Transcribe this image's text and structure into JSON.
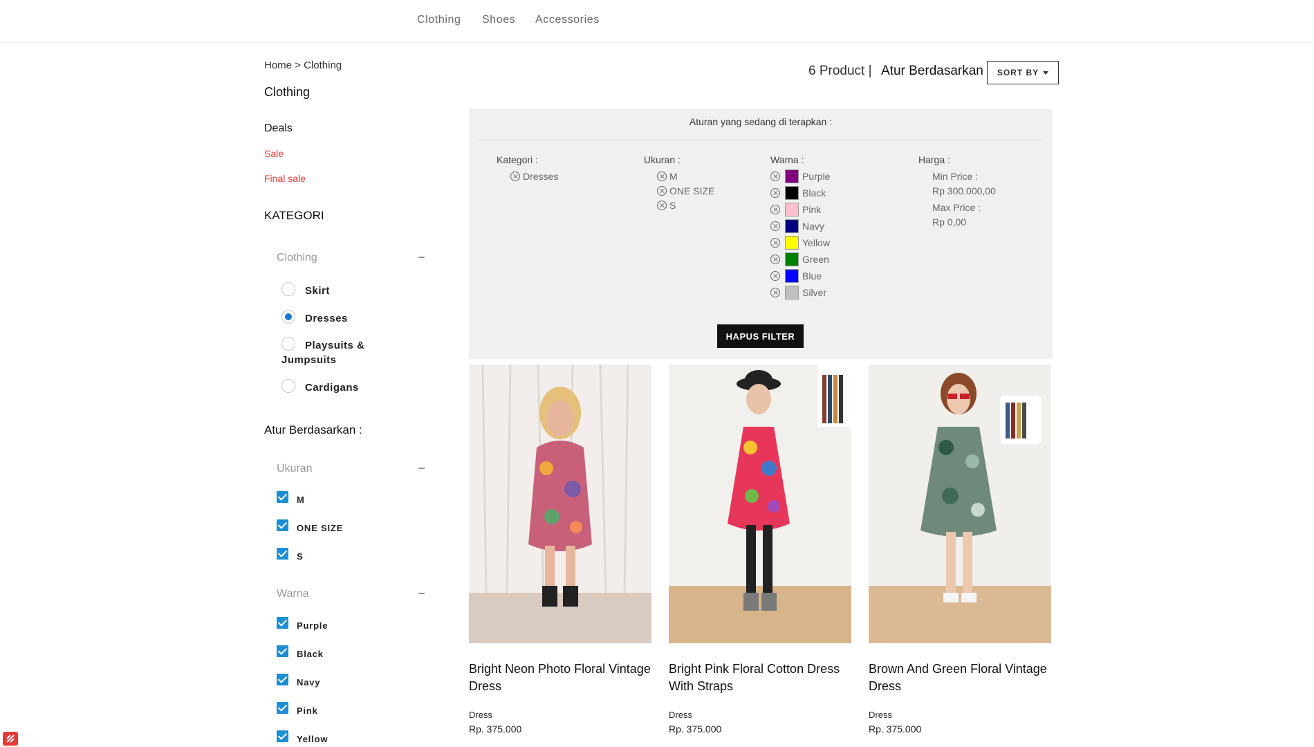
{
  "nav": {
    "items": [
      {
        "label": "Clothing"
      },
      {
        "label": "Shoes"
      },
      {
        "label": "Accessories"
      }
    ]
  },
  "sidebar": {
    "breadcrumb": "Home > Clothing",
    "page_title": "Clothing",
    "deals_title": "Deals",
    "deal_links": [
      "Sale",
      "Final sale"
    ],
    "category_title": "KATEGORI",
    "clothing_group": {
      "label": "Clothing",
      "toggle": "–",
      "options": [
        {
          "label": "Skirt",
          "selected": false
        },
        {
          "label": "Dresses",
          "selected": true
        },
        {
          "label": "Playsuits &",
          "label2": "Jumpsuits",
          "selected": false
        },
        {
          "label": "Cardigans",
          "selected": false
        }
      ]
    },
    "sort_title": "Atur Berdasarkan :",
    "size_group": {
      "label": "Ukuran",
      "toggle": "–",
      "options": [
        {
          "label": "M",
          "checked": true
        },
        {
          "label": "ONE SIZE",
          "checked": true
        },
        {
          "label": "S",
          "checked": true
        }
      ]
    },
    "color_group": {
      "label": "Warna",
      "toggle": "–",
      "options": [
        {
          "label": "Purple",
          "checked": true
        },
        {
          "label": "Black",
          "checked": true
        },
        {
          "label": "Navy",
          "checked": true
        },
        {
          "label": "Pink",
          "checked": true
        },
        {
          "label": "Yellow",
          "checked": true
        }
      ]
    }
  },
  "header": {
    "count": "6 Product |",
    "sort_label": "Atur Berdasarkan",
    "sort_button": "SORT BY"
  },
  "filters": {
    "title": "Aturan yang sedang di terapkan :",
    "kategori": {
      "label": "Kategori :",
      "items": [
        "Dresses"
      ]
    },
    "ukuran": {
      "label": "Ukuran :",
      "items": [
        "M",
        "ONE SIZE",
        "S"
      ]
    },
    "warna": {
      "label": "Warna :",
      "items": [
        {
          "name": "Purple",
          "color": "#800080"
        },
        {
          "name": "Black",
          "color": "#000000"
        },
        {
          "name": "Pink",
          "color": "#ffc0cb"
        },
        {
          "name": "Navy",
          "color": "#000080"
        },
        {
          "name": "Yellow",
          "color": "#ffff00"
        },
        {
          "name": "Green",
          "color": "#008000"
        },
        {
          "name": "Blue",
          "color": "#0000ff"
        },
        {
          "name": "Silver",
          "color": "#c0c0c0"
        }
      ]
    },
    "harga": {
      "label": "Harga :",
      "min_label": "Min Price :",
      "min_value": "Rp 300.000,00",
      "max_label": "Max Price :",
      "max_value": "Rp 0,00"
    },
    "clear_button": "HAPUS FILTER"
  },
  "products": [
    {
      "name_line1": "Bright Neon Photo Floral Vintage",
      "name_line2": "Dress",
      "type": "Dress",
      "price": "Rp. 375.000"
    },
    {
      "name_line1": "Bright Pink Floral Cotton Dress",
      "name_line2": "With Straps",
      "type": "Dress",
      "price": "Rp. 375.000"
    },
    {
      "name_line1": "Brown And Green Floral Vintage",
      "name_line2": "Dress",
      "type": "Dress",
      "price": "Rp. 375.000"
    }
  ],
  "colors": {
    "accent_blue": "#1a8fd6",
    "sale_red": "#e53935",
    "panel_bg": "#f0f0f0"
  }
}
